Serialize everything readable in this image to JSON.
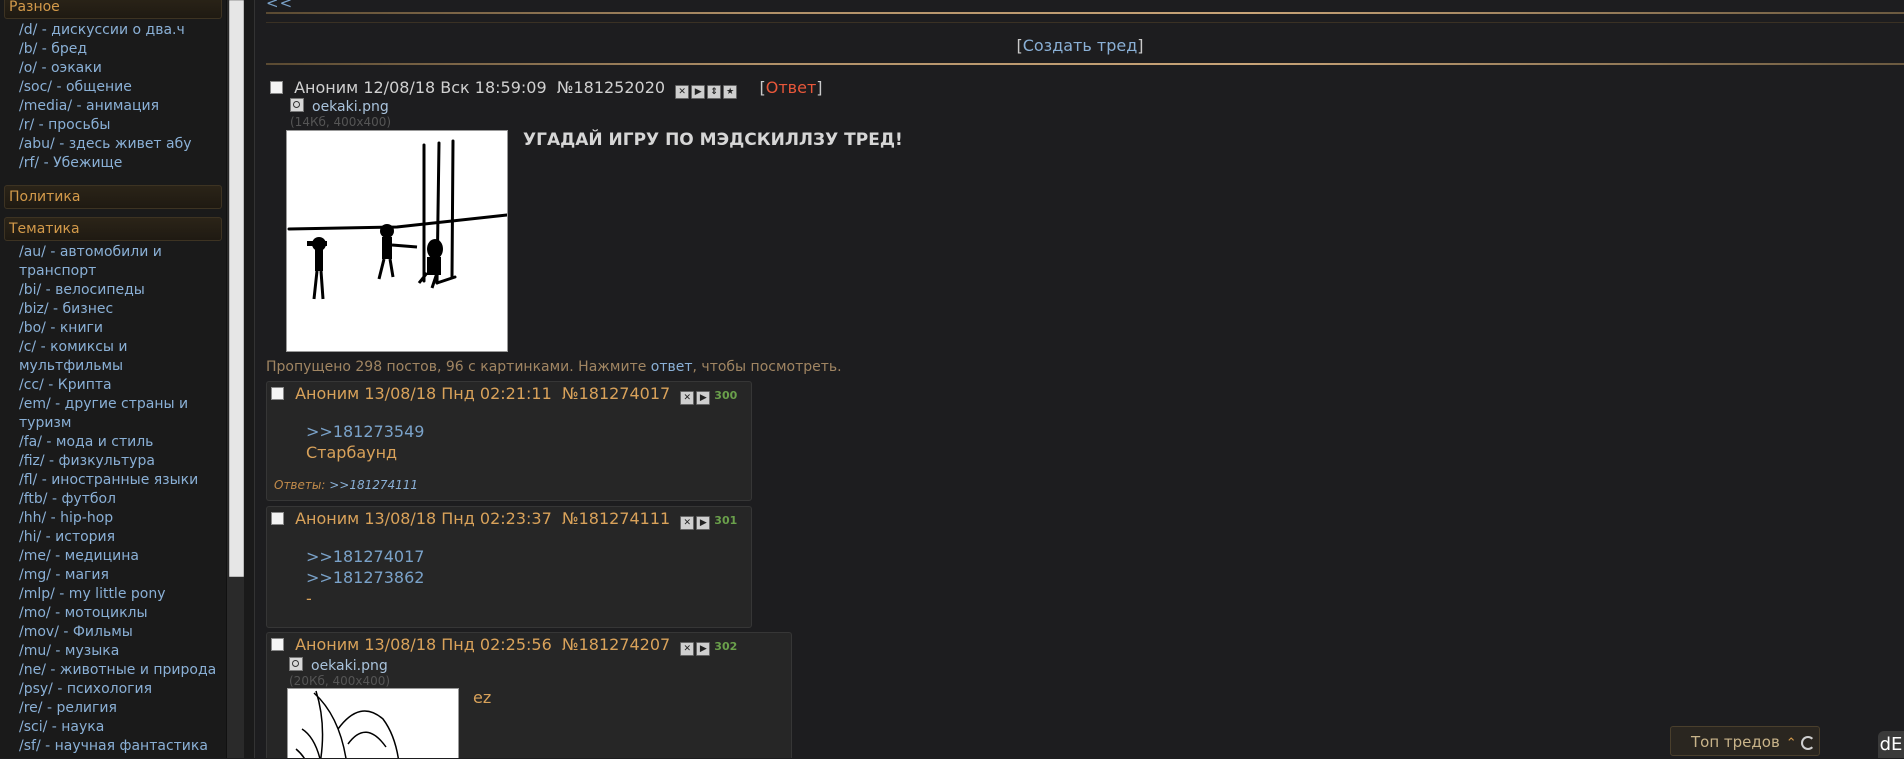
{
  "sidebar": {
    "groups": [
      {
        "title": "Разное",
        "items": [
          "/d/ - дискуссии о два.ч",
          "/b/ - бред",
          "/o/ - оэкаки",
          "/soc/ - общение",
          "/media/ - анимация",
          "/r/ - просьбы",
          "/abu/ - здесь живет абу",
          "/rf/ - Убежище"
        ]
      },
      {
        "title": "Политика",
        "items": []
      },
      {
        "title": "Тематика",
        "items": [
          "/au/ - автомобили и транспорт",
          "/bi/ - велосипеды",
          "/biz/ - бизнес",
          "/bo/ - книги",
          "/c/ - комиксы и мультфильмы",
          "/cc/ - Крипта",
          "/em/ - другие страны и туризм",
          "/fa/ - мода и стиль",
          "/fiz/ - физкультура",
          "/fl/ - иностранные языки",
          "/ftb/ - футбол",
          "/hh/ - hip-hop",
          "/hi/ - история",
          "/me/ - медицина",
          "/mg/ - магия",
          "/mlp/ - my little pony",
          "/mo/ - мотоциклы",
          "/mov/ - Фильмы",
          "/mu/ - музыка",
          "/ne/ - животные и природа",
          "/psy/ - психология",
          "/re/ - религия",
          "/sci/ - наука",
          "/sf/ - научная фантастика"
        ]
      }
    ]
  },
  "nav": {
    "back": "<<",
    "create_thread": "Создать тред",
    "bracket_open": "[",
    "bracket_close": "]"
  },
  "op": {
    "name": "Аноним",
    "date": "12/08/18 Вск 18:59:09",
    "number": "№181252020",
    "reply_link": "Ответ",
    "file_name": "oekaki.png",
    "file_meta": "(14Кб, 400x400)",
    "subject": "УГАДАЙ ИГРУ ПО МЭДСКИЛЛЗУ ТРЕД!"
  },
  "omitted": {
    "text_before": "Пропущено 298 постов, 96 с картинками. Нажмите ",
    "link": "ответ",
    "text_after": ", чтобы посмотреть."
  },
  "replies": [
    {
      "name": "Аноним",
      "date": "13/08/18 Пнд 02:21:11",
      "number": "№181274017",
      "count": "300",
      "lines": [
        {
          "kind": "ref",
          "text": ">>181273549"
        },
        {
          "kind": "txt",
          "text": "Старбаунд"
        }
      ],
      "replies_label": "Ответы:",
      "replies_link": ">>181274111"
    },
    {
      "name": "Аноним",
      "date": "13/08/18 Пнд 02:23:37",
      "number": "№181274111",
      "count": "301",
      "lines": [
        {
          "kind": "ref",
          "text": ">>181274017"
        },
        {
          "kind": "ref",
          "text": ">>181273862"
        },
        {
          "kind": "txt",
          "text": "-"
        }
      ]
    },
    {
      "name": "Аноним",
      "date": "13/08/18 Пнд 02:25:56",
      "number": "№181274207",
      "count": "302",
      "file_name": "oekaki.png",
      "file_meta": "(20Кб, 400x400)",
      "text": "ez"
    }
  ],
  "widgets": {
    "top_threads": "Топ тредов",
    "up_arrow": "⌃",
    "badge": "dE"
  }
}
